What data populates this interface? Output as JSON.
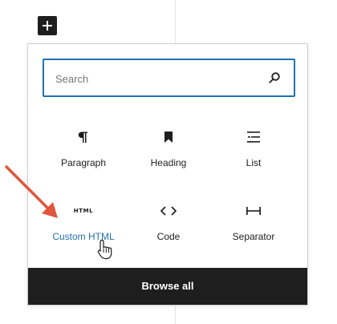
{
  "search": {
    "placeholder": "Search"
  },
  "blocks": [
    {
      "label": "Paragraph",
      "icon": "paragraph-icon"
    },
    {
      "label": "Heading",
      "icon": "heading-icon"
    },
    {
      "label": "List",
      "icon": "list-icon"
    },
    {
      "label": "Custom HTML",
      "icon": "html-icon",
      "icon_text": "HTML",
      "active": true
    },
    {
      "label": "Code",
      "icon": "code-icon"
    },
    {
      "label": "Separator",
      "icon": "separator-icon"
    }
  ],
  "browse_all_label": "Browse all",
  "colors": {
    "accent": "#2271b1",
    "dark": "#1e1e1e",
    "annotation_arrow": "#e0553c",
    "border": "#cfcfcf"
  }
}
